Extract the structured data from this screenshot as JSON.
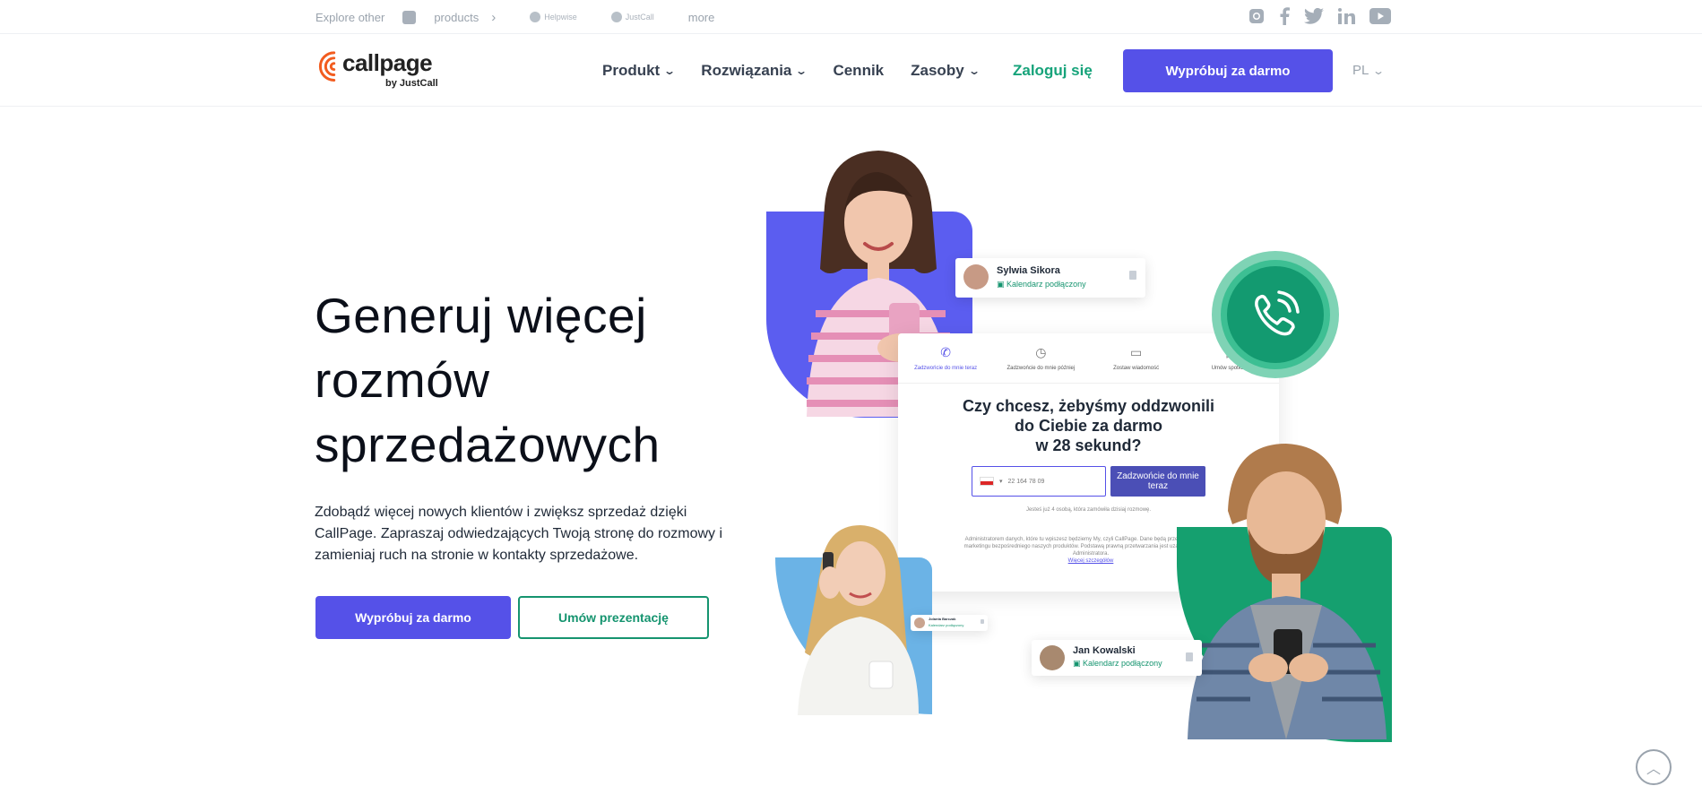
{
  "topbar": {
    "explore_label": "Explore other",
    "products_label": "products",
    "brand_helpwise": "Helpwise",
    "brand_justcall": "JustCall",
    "more_label": "more"
  },
  "header": {
    "logo_word": "callpage",
    "logo_sub": "by JustCall",
    "nav": {
      "produkt": "Produkt",
      "rozwiazania": "Rozwiązania",
      "cennik": "Cennik",
      "zasoby": "Zasoby"
    },
    "login_label": "Zaloguj się",
    "cta_label": "Wypróbuj za darmo",
    "lang_label": "PL"
  },
  "hero": {
    "title_line1": "Generuj więcej",
    "title_line2": "rozmów",
    "title_line3": "sprzedażowych",
    "description": "Zdobądź więcej nowych klientów i zwiększ sprzedaż dzięki CallPage. Zapraszaj odwiedzających Twoją stronę do rozmowy i zamieniaj ruch na stronie w kontakty sprzedażowe.",
    "primary_button": "Wypróbuj za darmo",
    "secondary_button": "Umów prezentację"
  },
  "widget": {
    "tabs": [
      {
        "label": "Zadzwońcie do mnie teraz"
      },
      {
        "label": "Zadzwońcie do mnie później"
      },
      {
        "label": "Zostaw wiadomość"
      },
      {
        "label": "Umów spotkanie"
      }
    ],
    "question_line1": "Czy chcesz, żebyśmy oddzwonili",
    "question_line2": "do Ciebie za darmo",
    "question_line3": "w 28 sekund?",
    "phone_value": "22 164 78 09",
    "call_button": "Zadzwońcie do mnie teraz",
    "note": "Jesteś już 4 osobą, która zamówiła dzisiaj rozmowę.",
    "legal": "Administratorem danych, które tu wpiszesz będziemy My, czyli CallPage. Dane będą przetwarzane w celu marketingu bezpośredniego naszych produktów. Podstawą prawną przetwarzania jest uzasadniony interes Administratora.",
    "legal_link": "Więcej szczegółów"
  },
  "cards": {
    "card1_name": "Sylwia Sikora",
    "card1_status": "Kalendarz podłączony",
    "card2_name": "Jolanta Barczak",
    "card2_status": "Kalendarz podłączony",
    "card3_name": "Jan Kowalski",
    "card3_status": "Kalendarz podłączony"
  },
  "colors": {
    "accent": "#5551e8",
    "green": "#15946f"
  }
}
